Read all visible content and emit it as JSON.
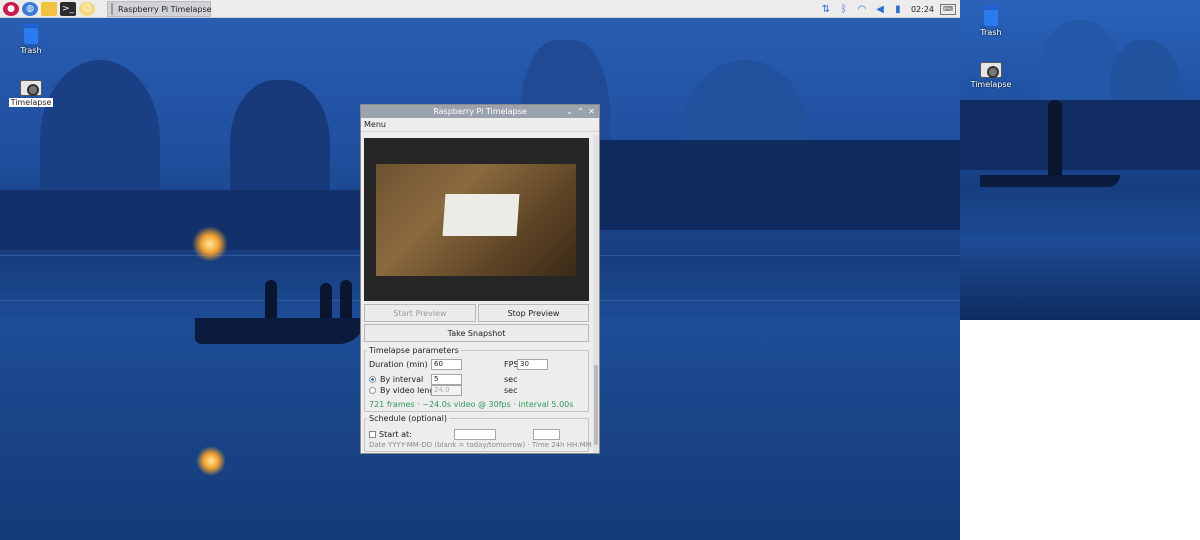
{
  "taskbar": {
    "launchers": [
      "raspberry-icon",
      "browser-icon",
      "folder-icon",
      "terminal-icon",
      "geany-icon"
    ],
    "task_title": "Raspberry Pi Timelapse",
    "clock": "02:24"
  },
  "desktop": {
    "icons": [
      {
        "label": "Trash"
      },
      {
        "label": "Timelapse"
      }
    ]
  },
  "second_screen": {
    "icons": [
      {
        "label": "Trash"
      },
      {
        "label": "Timelapse"
      }
    ]
  },
  "window": {
    "title": "Raspberry Pi Timelapse",
    "menu": "Menu",
    "buttons": {
      "start_preview": "Start Preview",
      "stop_preview": "Stop Preview",
      "take_snapshot": "Take Snapshot"
    },
    "timelapse": {
      "legend": "Timelapse parameters",
      "duration_label": "Duration (min)",
      "duration_value": "60",
      "fps_label": "FPS",
      "fps_value": "30",
      "by_interval_label": "By interval",
      "interval_value": "5",
      "interval_unit": "sec",
      "by_video_label": "By video length",
      "video_value": "24.0",
      "video_unit": "sec",
      "summary_frames": "721 frames",
      "summary_sep": "·",
      "summary_video": "~24.0s video @ 30fps",
      "summary_interval": "interval 5.00s"
    },
    "schedule": {
      "legend": "Schedule (optional)",
      "start_label": "Start at:",
      "date_value": "",
      "time_value": "",
      "hint": "Date YYYY-MM-DD (blank = today/tomorrow) · Time 24h HH:MM"
    }
  },
  "colors": {
    "summary_green": "#2f9a5a",
    "selection_blue": "#2c6bd3"
  }
}
